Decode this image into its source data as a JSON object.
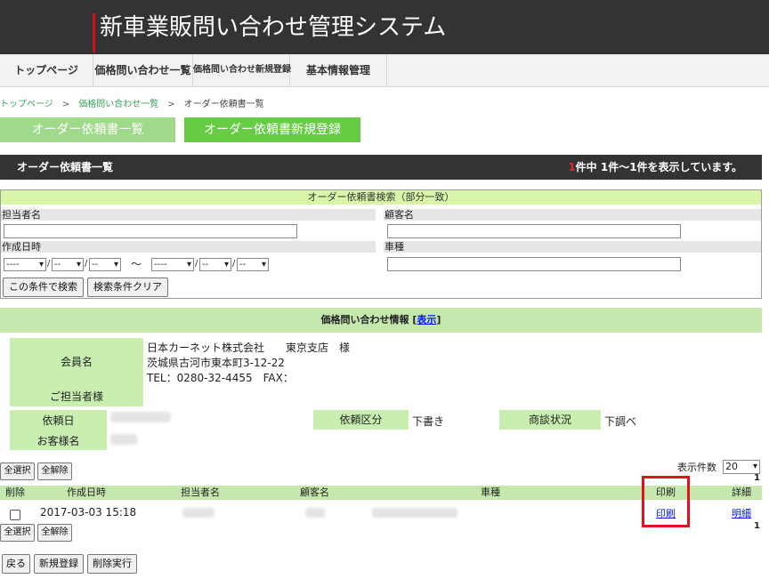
{
  "app": {
    "title": "新車業販問い合わせ管理システム"
  },
  "nav": {
    "items": [
      {
        "label": "トップページ"
      },
      {
        "label": "価格問い合わせ一覧"
      },
      {
        "label": "価格問い合わせ新規登録"
      },
      {
        "label": "基本情報管理"
      }
    ]
  },
  "breadcrumb": {
    "items": [
      "トップページ",
      "価格問い合わせ一覧"
    ],
    "separator": ">",
    "current": "オーダー依頼書一覧"
  },
  "actions": {
    "order_list": "オーダー依頼書一覧",
    "order_new": "オーダー依頼書新規登録"
  },
  "listbar": {
    "title": "オーダー依頼書一覧",
    "count": "1",
    "count_suffix": "件中 1件～1件を表示しています。"
  },
  "search": {
    "header": "オーダー依頼書検索（部分一致）",
    "person_label": "担当者名",
    "customer_label": "顧客名",
    "date_label": "作成日時",
    "car_label": "車種",
    "year_value": "----",
    "month_value": "--",
    "day_value": "--",
    "slash": "/",
    "tilde": "～",
    "search_button": "この条件で検索",
    "clear_button": "検索条件クリア"
  },
  "info": {
    "header": "価格問い合わせ情報",
    "show_link": "表示",
    "bracket_open": "[",
    "bracket_close": "]",
    "member_label": "会員名",
    "person_label": "ご担当者様",
    "company": "日本カーネット株式会社　　東京支店　様",
    "address": "茨城県古河市東本町3-12-22",
    "tel": "TEL：0280-32-4455　FAX：",
    "request_date_label": "依頼日",
    "customer_label": "お客様名",
    "request_type_label": "依頼区分",
    "request_type_value": "下書き",
    "status_label": "商談状況",
    "status_value": "下調べ"
  },
  "table": {
    "select_all": "全選択",
    "deselect_all": "全解除",
    "per_page_label": "表示件数",
    "per_page_value": "20",
    "page_number": "1",
    "columns": [
      "削除",
      "作成日時",
      "担当者名",
      "顧客名",
      "車種",
      "印刷",
      "詳細"
    ],
    "rows": [
      {
        "created": "2017-03-03 15:18",
        "print": "印刷",
        "detail": "明細"
      }
    ]
  },
  "footer": {
    "back": "戻る",
    "new": "新規登録",
    "delete": "削除実行"
  },
  "colors": {
    "header_bg": "#333333",
    "accent_red": "#d01020",
    "button_green": "#66cc44",
    "button_green_light": "#9fd98a",
    "info_green": "#c5e8ae",
    "link_blue": "#0019e0"
  }
}
